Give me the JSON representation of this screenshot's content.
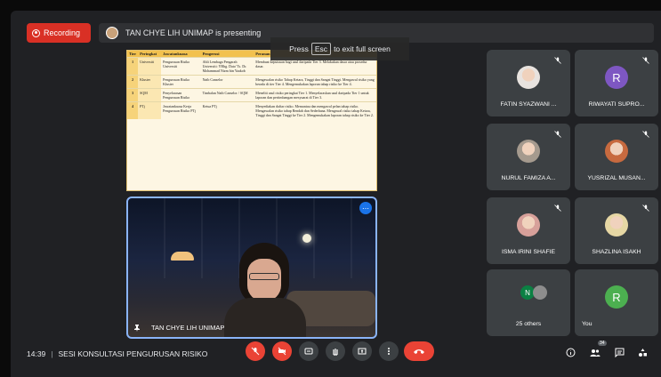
{
  "recording": {
    "label": "Recording"
  },
  "presenting_banner": {
    "text": "TAN CHYE LIH UNIMAP is presenting"
  },
  "esc_tip": {
    "pre": "Press",
    "key": "Esc",
    "post": "to exit full screen"
  },
  "slide": {
    "headers": [
      "Tier",
      "Peringkat",
      "Jawatankuasa",
      "Pengerusi",
      "Peranan"
    ],
    "rows": [
      {
        "tier": "1",
        "level": "Universiti",
        "committee": "Pengurusan Risiko Universiti",
        "chair": "Ahli Lembaga Pengarah Universiti: YBhg. Dato' Ts. Dr. Mohammad Nizm bin Yaakob",
        "role": "Membuat keputusan bagi usul daripada Tier 3. Melakukan dasar atau prosedur dasar."
      },
      {
        "tier": "2",
        "level": "Kluster",
        "committee": "Pengurusan Risiko Kluster",
        "chair": "Naib Canselor",
        "role": "Mengawalan risiko Tahap Ketara, Tinggi dan Sangat Tinggi. Mengawal risiko yang berada di tier Tier 4. Mengemukakan laporan tahap risiko ke Tier 4."
      },
      {
        "tier": "3",
        "level": "SQM",
        "committee": "Penyelarasan Pengurusan Risiko",
        "chair": "Timbalan Naib Canselor / SQM",
        "role": "Meneliti usul risiko peringkat Tier 1. Menyelaraskan usul daripada Tier 1 untuk laporan dan pertimbangan mesyuarat di Tier 3."
      },
      {
        "tier": "4",
        "level": "PTj",
        "committee": "Jawatankuasa Kerja Pengurusan Risiko PTj",
        "chair": "Ketua PTj",
        "role": "Menyediakan daftar risiko. Memantau dan mengawal pelan tahap risiko. Mengawalan risiko tahap Rendah dan Sederhana. Mengawal risiko tahap Ketara, Tinggi dan Sangat Tinggi ke Tier 2. Mengemukakan laporan tahap risiko ke Tier 2."
      }
    ]
  },
  "presenter": {
    "name": "TAN CHYE LIH UNIMAP"
  },
  "participants": [
    {
      "name": "FATIN SYAZWANI ...",
      "avatar": "photo",
      "color": "#e8e3df"
    },
    {
      "name": "RIWAYATI SUPRO...",
      "avatar": "initial",
      "initial": "R",
      "color": "#7e57c2"
    },
    {
      "name": "NURUL FAMIZA A...",
      "avatar": "photo",
      "color": "#a59a8e"
    },
    {
      "name": "YUSRIZAL MUSAN...",
      "avatar": "photo",
      "color": "#c76a3f"
    },
    {
      "name": "ISMA IRINI SHAFIE",
      "avatar": "photo",
      "color": "#d7a09a"
    },
    {
      "name": "SHAZLINA ISAKH",
      "avatar": "photo",
      "color": "#e6d7a4"
    },
    {
      "name": "25 others",
      "avatar": "group",
      "initial": "N",
      "color": "#0b8043"
    },
    {
      "name": "You",
      "avatar": "initial",
      "initial": "R",
      "color": "#4caf50"
    }
  ],
  "meeting": {
    "time": "14:39",
    "title": "SESI KONSULTASI PENGURUSAN RISIKO",
    "participant_count": "34"
  },
  "colors": {
    "accent": "#8ab4f8",
    "danger": "#ea4335",
    "tile": "#3c4043"
  }
}
